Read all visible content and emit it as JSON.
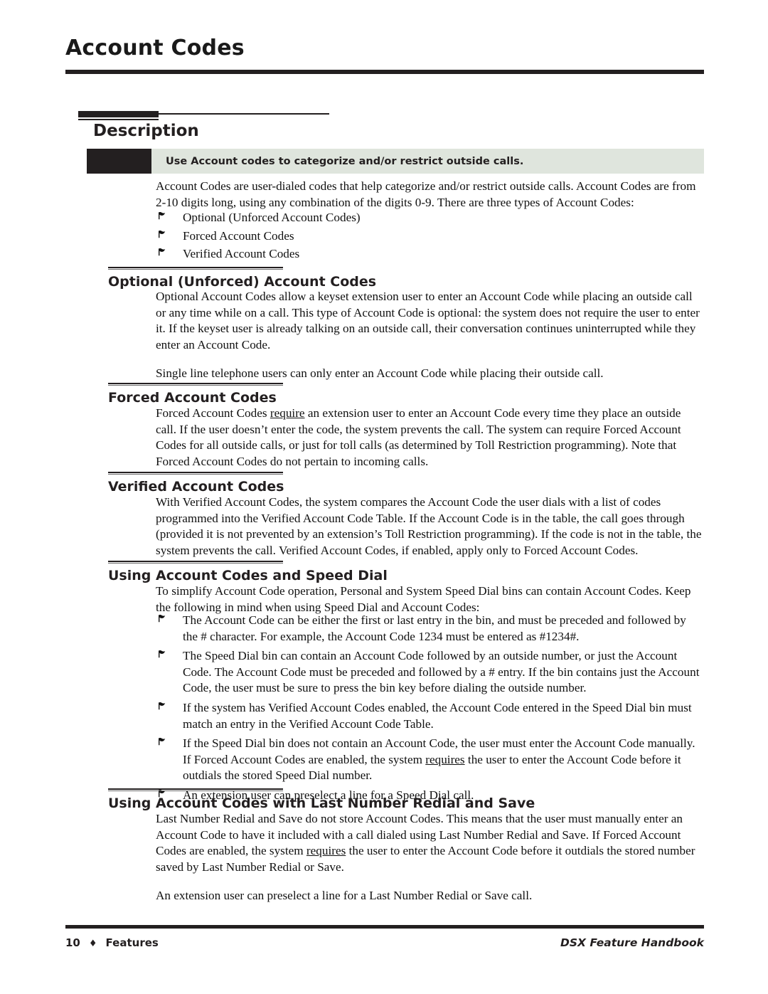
{
  "page": {
    "title": "Account Codes"
  },
  "section": {
    "title": "Description",
    "callout": "Use Account codes to categorize and/or restrict outside calls.",
    "intro": "Account Codes are user-dialed codes that help categorize and/or restrict outside calls. Account Codes are from 2-10 digits long, using any combination of the digits 0-9. There are three types of Account Codes:",
    "intro_bullets": [
      "Optional (Unforced Account Codes)",
      "Forced Account Codes",
      "Verified Account Codes"
    ]
  },
  "subsections": {
    "optional": {
      "title": "Optional (Unforced) Account Codes",
      "para1": "Optional Account Codes allow a keyset extension user to enter an Account Code while placing an outside call or any time while on a call. This type of Account Code is optional: the system does not require the user to enter it. If the keyset user is already talking on an outside call, their conversation continues uninterrupted while they enter an Account Code.",
      "para2": "Single line telephone users can only enter an Account Code while placing their outside call."
    },
    "forced": {
      "title": "Forced Account Codes",
      "para1_a": "Forced Account Codes ",
      "para1_u": "require",
      "para1_b": " an extension user to enter an Account Code every time they place an outside call. If the user doesn’t enter the code, the system prevents the call. The system can require Forced Account Codes for all outside calls, or just for toll calls (as determined by Toll Restriction programming). Note that Forced Account Codes do not pertain to incoming calls."
    },
    "verified": {
      "title": "Verified Account Codes",
      "para1": "With Verified Account Codes, the system compares the Account Code the user dials with a list of codes programmed into the Verified Account Code Table. If the Account Code is in the table, the call goes through (provided it is not prevented by an extension’s Toll Restriction programming). If the code is not in the table, the system prevents the call. Verified Account Codes, if enabled, apply only to Forced Account Codes."
    },
    "speed_dial": {
      "title": "Using Account Codes and Speed Dial",
      "para1": "To simplify Account Code operation, Personal and System Speed Dial bins can contain Account Codes. Keep the following in mind when using Speed Dial and Account Codes:",
      "bullet1": "The Account Code can be either the first or last entry in the bin, and must be preceded and followed by the # character. For example, the Account Code 1234 must be entered as #1234#.",
      "bullet2": "The Speed Dial bin can contain an Account Code followed by an outside number, or just the Account Code. The Account Code must be preceded and followed by a # entry. If the bin contains just the Account Code, the user must be sure to press the bin key before dialing the outside number.",
      "bullet3": "If the system has Verified Account Codes enabled, the Account Code entered in the Speed Dial bin must match an entry in the Verified Account Code Table.",
      "bullet4_a": "If the Speed Dial bin does not contain an Account Code, the user must enter the Account Code manually. If Forced Account Codes are enabled, the system ",
      "bullet4_u": "requires",
      "bullet4_b": " the user to enter the Account Code before it outdials the stored Speed Dial number.",
      "bullet5": "An extension user can preselect a line for a Speed Dial call."
    },
    "redial": {
      "title": "Using Account Codes with Last Number Redial and Save",
      "para1_a": "Last Number Redial and Save do not store Account Codes. This means that the user must manually enter an Account Code to have it included with a call dialed using Last Number Redial and Save. If Forced Account Codes are enabled, the system ",
      "para1_u": "requires",
      "para1_b": " the user to enter the Account Code before it outdials the stored number saved by Last Number Redial or Save.",
      "para2": "An extension user can preselect a line for a Last Number Redial or Save call."
    }
  },
  "footer": {
    "page_number": "10",
    "diamond": "♦",
    "section_label": "Features",
    "book_title": "DSX Feature Handbook"
  },
  "colors": {
    "ink": "#231f20",
    "callout_bg": "#dfe5dd",
    "callout_swatch": "#231f20"
  }
}
